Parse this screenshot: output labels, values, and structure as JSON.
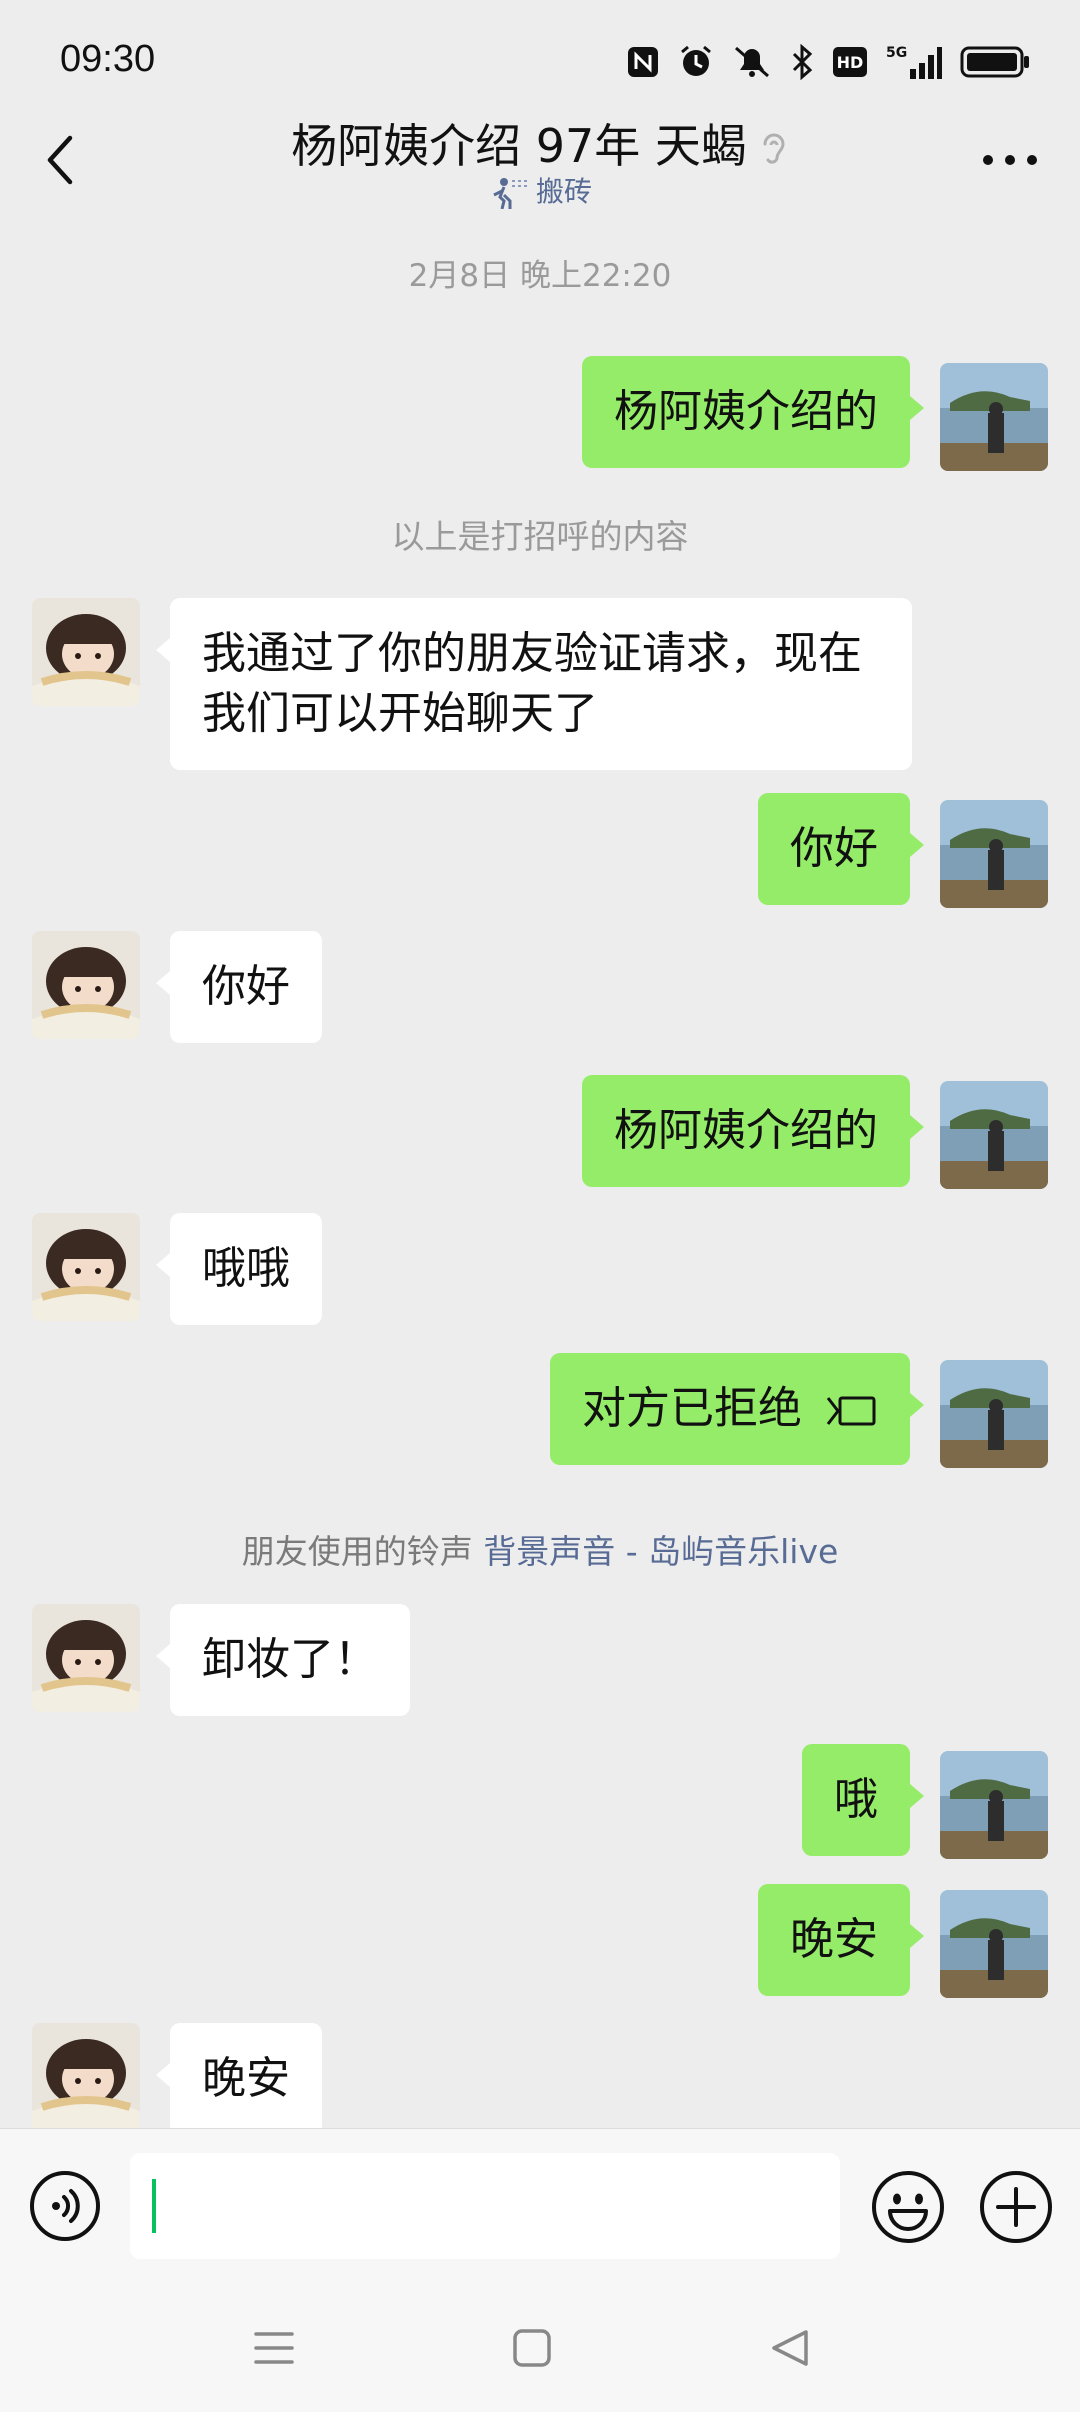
{
  "status": {
    "time": "09:30"
  },
  "header": {
    "title": "杨阿姨介绍 97年 天蝎",
    "subtitle": "搬砖"
  },
  "messages": [
    {
      "type": "time",
      "text": "2月8日 晚上22:20"
    },
    {
      "type": "out",
      "text": "杨阿姨介绍的"
    },
    {
      "type": "system",
      "text": "以上是打招呼的内容"
    },
    {
      "type": "in",
      "text": "我通过了你的朋友验证请求，现在我们可以开始聊天了"
    },
    {
      "type": "out",
      "text": "你好"
    },
    {
      "type": "in",
      "text": "你好"
    },
    {
      "type": "out",
      "text": "杨阿姨介绍的"
    },
    {
      "type": "in",
      "text": "哦哦"
    },
    {
      "type": "out",
      "text": "对方已拒绝"
    },
    {
      "type": "ringtone",
      "prefix": "朋友使用的铃声",
      "link": "背景声音 - 岛屿音乐live"
    },
    {
      "type": "in",
      "text": "卸妆了！"
    },
    {
      "type": "out",
      "text": "哦"
    },
    {
      "type": "out",
      "text": "晚安"
    },
    {
      "type": "in",
      "text": "晚安"
    }
  ],
  "colors": {
    "background": "#ededed",
    "outgoing_bubble": "#95ec69",
    "incoming_bubble": "#ffffff",
    "link": "#576b95",
    "cursor": "#07c160"
  },
  "icons": {
    "back": "chevron-left-icon",
    "more": "more-dots-icon",
    "voice": "voice-icon",
    "emoji": "emoji-icon",
    "plus": "plus-icon",
    "call": "call-icon"
  }
}
